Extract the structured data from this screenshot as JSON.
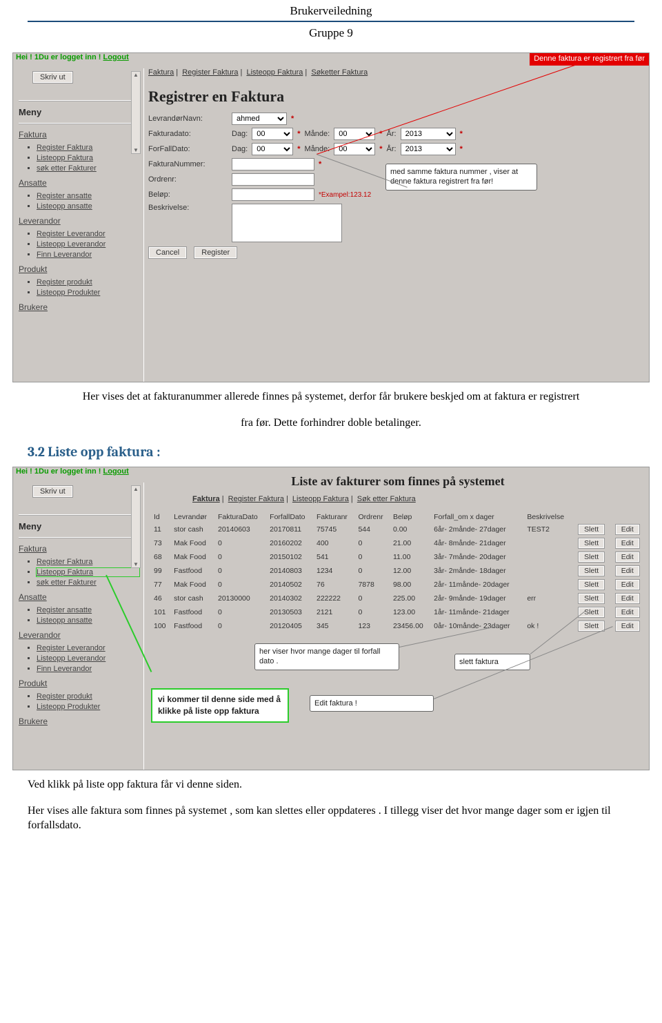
{
  "doc": {
    "header": "Brukerveiledning",
    "group": "Gruppe 9",
    "p1a": "Her vises det at fakturanummer allerede finnes på systemet, derfor får brukere beskjed om at faktura er registrert",
    "p1b": "fra  før. Dette forhindrer doble betalinger.",
    "section": "3.2 Liste opp faktura :",
    "p2a": "Ved klikk på liste opp faktura får vi denne siden.",
    "p2b": "Her vises alle faktura som finnes på systemet , som kan slettes eller oppdateres . I tillegg viser  det hvor mange dager som er igjen til forfallsdato."
  },
  "shot1": {
    "greeting_prefix": "Hei ! 1Du er logget inn ! ",
    "logout": "Logout",
    "red_banner": "Denne faktura er registrert fra før",
    "skriv_ut": "Skriv ut",
    "meny": "Meny",
    "sb_sections": {
      "faktura": "Faktura",
      "faktura_items": [
        "Register Faktura",
        "Listeopp Faktura",
        "søk etter Fakturer"
      ],
      "ansatte": "Ansatte",
      "ansatte_items": [
        "Register ansatte",
        "Listeopp ansatte"
      ],
      "leverandor": "Leverandor",
      "leverandor_items": [
        "Register Leverandor",
        "Listeopp Leverandor",
        "Finn Leverandor"
      ],
      "produkt": "Produkt",
      "produkt_items": [
        "Register produkt",
        "Listeopp Produkter"
      ],
      "brukere": "Brukere"
    },
    "crumbs": {
      "a": "Faktura",
      "b": "Register Faktura",
      "c": "Listeopp Faktura",
      "d": "Søketter Faktura"
    },
    "title": "Registrer en Faktura",
    "labels": {
      "levnavn": "LevrandørNavn:",
      "fdato": "Fakturadato:",
      "forfall": "ForFallDato:",
      "fnr": "FakturaNummer:",
      "ordrenr": "Ordrenr:",
      "belop": "Beløp:",
      "beskriv": "Beskrivelse:",
      "dag": "Dag:",
      "mande": "Månde:",
      "ar": "År:"
    },
    "selects": {
      "lev": "ahmed",
      "dag1": "00",
      "mande1": "00",
      "ar1": "2013",
      "dag2": "00",
      "mande2": "00",
      "ar2": "2013"
    },
    "hint": "*Exampel:123.12",
    "cancel": "Cancel",
    "register": "Register",
    "callout": "med samme faktura nummer , viser at denne faktura registrert fra før!"
  },
  "shot2": {
    "greeting_prefix": "Hei ! 1Du er logget inn ! ",
    "logout": "Logout",
    "skriv_ut": "Skriv ut",
    "meny": "Meny",
    "title": "Liste av fakturer som finnes på systemet",
    "crumbs": {
      "a": "Faktura",
      "b": "Register Faktura",
      "c": "Listeopp Faktura",
      "d": "Søk etter Faktura"
    },
    "headers": [
      "Id",
      "Levrandør",
      "FakturaDato",
      "ForfallDato",
      "Fakturanr",
      "Ordrenr",
      "Beløp",
      "Forfall_om x dager",
      "Beskrivelse"
    ],
    "rows": [
      {
        "id": "11",
        "lev": "stor cash",
        "fd": "20140603",
        "ffd": "20170811",
        "fnr": "75745",
        "ord": "544",
        "bel": "0.00",
        "forf": "6år- 2månde- 27dager",
        "besk": "TEST2"
      },
      {
        "id": "73",
        "lev": "Mak Food",
        "fd": "0",
        "ffd": "20160202",
        "fnr": "400",
        "ord": "0",
        "bel": "21.00",
        "forf": "4år- 8månde- 21dager",
        "besk": ""
      },
      {
        "id": "68",
        "lev": "Mak Food",
        "fd": "0",
        "ffd": "20150102",
        "fnr": "541",
        "ord": "0",
        "bel": "11.00",
        "forf": "3år- 7månde- 20dager",
        "besk": ""
      },
      {
        "id": "99",
        "lev": "Fastfood",
        "fd": "0",
        "ffd": "20140803",
        "fnr": "1234",
        "ord": "0",
        "bel": "12.00",
        "forf": "3år- 2månde- 18dager",
        "besk": ""
      },
      {
        "id": "77",
        "lev": "Mak Food",
        "fd": "0",
        "ffd": "20140502",
        "fnr": "76",
        "ord": "7878",
        "bel": "98.00",
        "forf": "2år- 11månde- 20dager",
        "besk": ""
      },
      {
        "id": "46",
        "lev": "stor cash",
        "fd": "20130000",
        "ffd": "20140302",
        "fnr": "222222",
        "ord": "0",
        "bel": "225.00",
        "forf": "2år- 9månde- 19dager",
        "besk": "err"
      },
      {
        "id": "101",
        "lev": "Fastfood",
        "fd": "0",
        "ffd": "20130503",
        "fnr": "2121",
        "ord": "0",
        "bel": "123.00",
        "forf": "1år- 11månde- 21dager",
        "besk": ""
      },
      {
        "id": "100",
        "lev": "Fastfood",
        "fd": "0",
        "ffd": "20120405",
        "fnr": "345",
        "ord": "123",
        "bel": "23456.00",
        "forf": "0år- 10månde- 23dager",
        "besk": "ok !"
      }
    ],
    "btn_slett": "Slett",
    "btn_edit": "Edit",
    "sb_sections": {
      "faktura": "Faktura",
      "faktura_items": [
        "Register Faktura",
        "Listeopp Faktura",
        "søk etter Fakturer"
      ],
      "ansatte": "Ansatte",
      "ansatte_items": [
        "Register ansatte",
        "Listeopp ansatte"
      ],
      "leverandor": "Leverandor",
      "leverandor_items": [
        "Register Leverandor",
        "Listeopp Leverandor",
        "Finn Leverandor"
      ],
      "produkt": "Produkt",
      "produkt_items": [
        "Register produkt",
        "Listeopp Produkter"
      ],
      "brukere": "Brukere"
    },
    "callout_days": "her viser hvor mange dager til forfall dato .",
    "callout_slett": "slett faktura",
    "callout_edit": "Edit faktura !",
    "callout_green": "vi kommer  til denne side med å klikke på liste opp faktura"
  }
}
